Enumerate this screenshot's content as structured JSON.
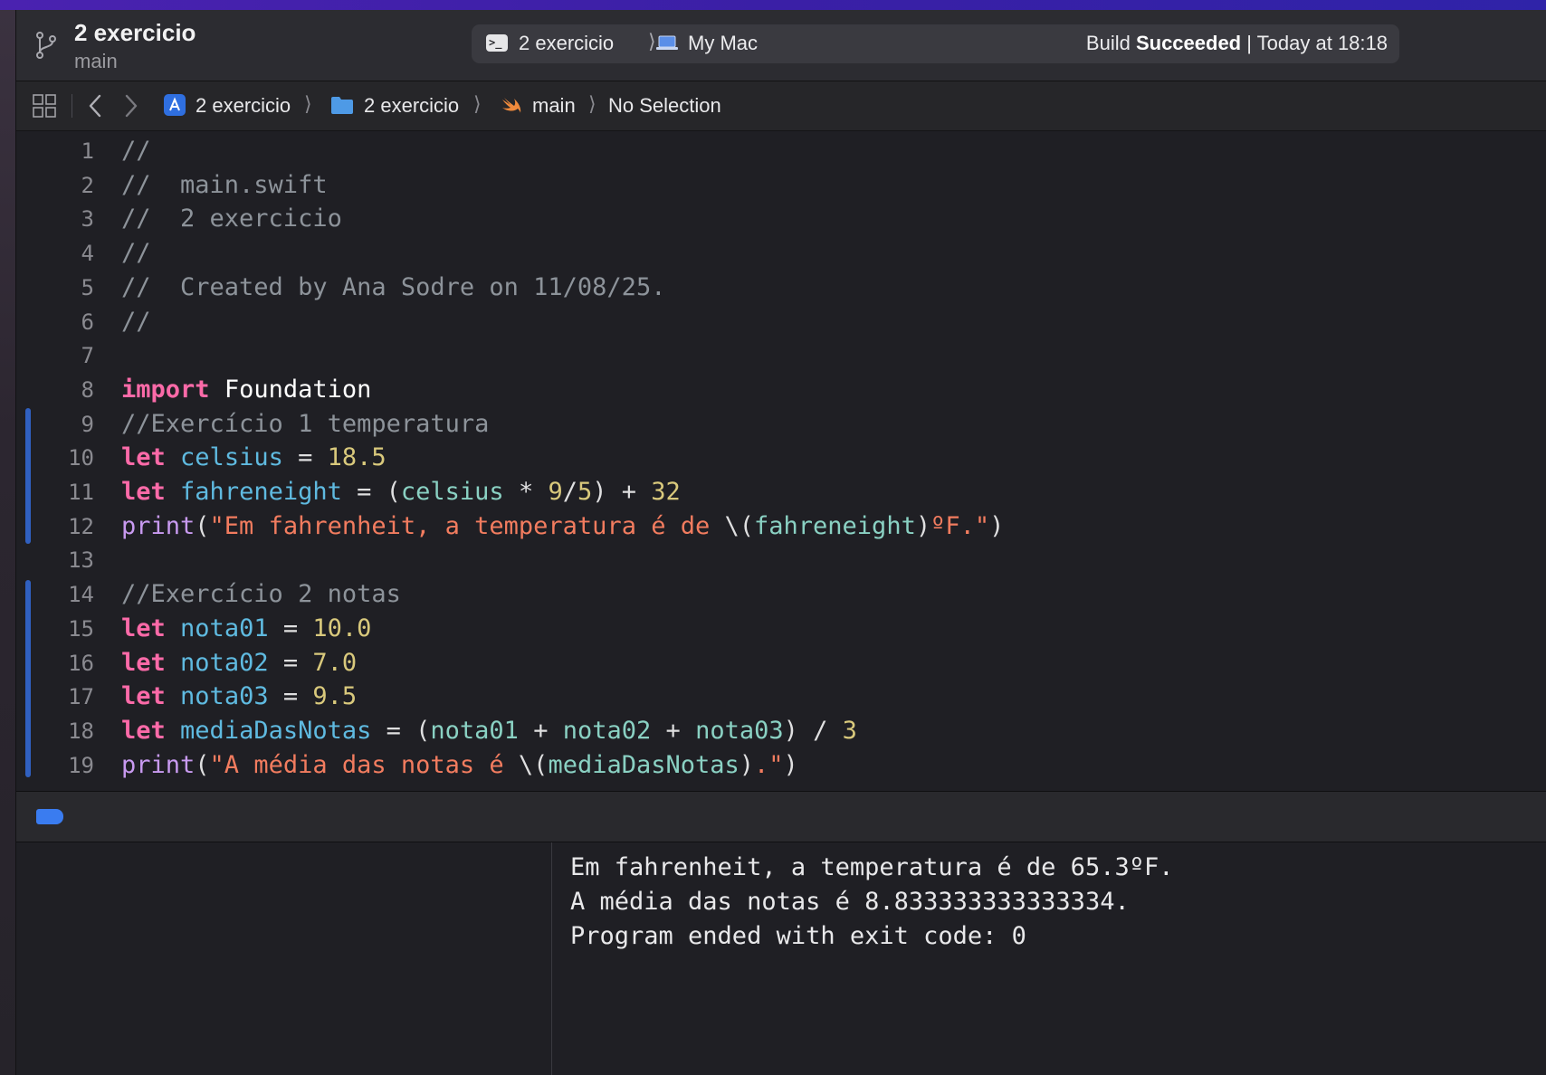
{
  "toolbar": {
    "project_name": "2 exercicio",
    "branch": "main",
    "scheme": "2 exercicio",
    "destination": "My Mac",
    "build_prefix": "Build ",
    "build_result": "Succeeded",
    "build_time": " | Today at 18:18"
  },
  "jumpbar": {
    "crumbs": [
      "2 exercicio",
      "2 exercicio",
      "main",
      "No Selection"
    ],
    "separator": "⟩"
  },
  "editor": {
    "lines": [
      {
        "n": "1",
        "tokens": [
          [
            "c-comment",
            "//"
          ]
        ]
      },
      {
        "n": "2",
        "tokens": [
          [
            "c-comment",
            "//  main.swift"
          ]
        ]
      },
      {
        "n": "3",
        "tokens": [
          [
            "c-comment",
            "//  2 exercicio"
          ]
        ]
      },
      {
        "n": "4",
        "tokens": [
          [
            "c-comment",
            "//"
          ]
        ]
      },
      {
        "n": "5",
        "tokens": [
          [
            "c-comment",
            "//  Created by Ana Sodre on 11/08/25."
          ]
        ]
      },
      {
        "n": "6",
        "tokens": [
          [
            "c-comment",
            "//"
          ]
        ]
      },
      {
        "n": "7",
        "tokens": []
      },
      {
        "n": "8",
        "tokens": [
          [
            "c-kw",
            "import"
          ],
          [
            "c-plain",
            " "
          ],
          [
            "c-type",
            "Foundation"
          ]
        ]
      },
      {
        "n": "9",
        "tokens": [
          [
            "c-comment",
            "//Exercício 1 temperatura"
          ]
        ]
      },
      {
        "n": "10",
        "tokens": [
          [
            "c-kw",
            "let"
          ],
          [
            "c-plain",
            " "
          ],
          [
            "c-decl",
            "celsius"
          ],
          [
            "c-plain",
            " = "
          ],
          [
            "c-num",
            "18.5"
          ]
        ]
      },
      {
        "n": "11",
        "tokens": [
          [
            "c-kw",
            "let"
          ],
          [
            "c-plain",
            " "
          ],
          [
            "c-decl",
            "fahreneight"
          ],
          [
            "c-plain",
            " = ("
          ],
          [
            "c-ref",
            "celsius"
          ],
          [
            "c-plain",
            " * "
          ],
          [
            "c-num",
            "9"
          ],
          [
            "c-plain",
            "/"
          ],
          [
            "c-num",
            "5"
          ],
          [
            "c-plain",
            ") + "
          ],
          [
            "c-num",
            "32"
          ]
        ]
      },
      {
        "n": "12",
        "tokens": [
          [
            "c-fn",
            "print"
          ],
          [
            "c-plain",
            "("
          ],
          [
            "c-str",
            "\"Em fahrenheit, a temperatura é de "
          ],
          [
            "c-plain",
            "\\("
          ],
          [
            "c-ref",
            "fahreneight"
          ],
          [
            "c-plain",
            ")"
          ],
          [
            "c-str",
            "ºF.\""
          ],
          [
            "c-plain",
            ")"
          ]
        ]
      },
      {
        "n": "13",
        "tokens": []
      },
      {
        "n": "14",
        "tokens": [
          [
            "c-comment",
            "//Exercício 2 notas"
          ]
        ]
      },
      {
        "n": "15",
        "tokens": [
          [
            "c-kw",
            "let"
          ],
          [
            "c-plain",
            " "
          ],
          [
            "c-decl",
            "nota01"
          ],
          [
            "c-plain",
            " = "
          ],
          [
            "c-num",
            "10.0"
          ]
        ]
      },
      {
        "n": "16",
        "tokens": [
          [
            "c-kw",
            "let"
          ],
          [
            "c-plain",
            " "
          ],
          [
            "c-decl",
            "nota02"
          ],
          [
            "c-plain",
            " = "
          ],
          [
            "c-num",
            "7.0"
          ]
        ]
      },
      {
        "n": "17",
        "tokens": [
          [
            "c-kw",
            "let"
          ],
          [
            "c-plain",
            " "
          ],
          [
            "c-decl",
            "nota03"
          ],
          [
            "c-plain",
            " = "
          ],
          [
            "c-num",
            "9.5"
          ]
        ]
      },
      {
        "n": "18",
        "tokens": [
          [
            "c-kw",
            "let"
          ],
          [
            "c-plain",
            " "
          ],
          [
            "c-decl",
            "mediaDasNotas"
          ],
          [
            "c-plain",
            " = ("
          ],
          [
            "c-ref",
            "nota01"
          ],
          [
            "c-plain",
            " + "
          ],
          [
            "c-ref",
            "nota02"
          ],
          [
            "c-plain",
            " + "
          ],
          [
            "c-ref",
            "nota03"
          ],
          [
            "c-plain",
            ") / "
          ],
          [
            "c-num",
            "3"
          ]
        ]
      },
      {
        "n": "19",
        "tokens": [
          [
            "c-fn",
            "print"
          ],
          [
            "c-plain",
            "("
          ],
          [
            "c-str",
            "\"A média das notas é "
          ],
          [
            "c-plain",
            "\\("
          ],
          [
            "c-ref",
            "mediaDasNotas"
          ],
          [
            "c-plain",
            ")"
          ],
          [
            "c-str",
            ".\""
          ],
          [
            "c-plain",
            ")"
          ]
        ]
      }
    ]
  },
  "console": {
    "lines": [
      "Em fahrenheit, a temperatura é de 65.3ºF.",
      "A média das notas é 8.833333333333334.",
      "Program ended with exit code: 0"
    ]
  },
  "colors": {
    "accent": "#3a7cf0",
    "keyword": "#fb6aa8",
    "string": "#f27c5f",
    "number": "#d9c97c",
    "comment": "#8d939a"
  }
}
